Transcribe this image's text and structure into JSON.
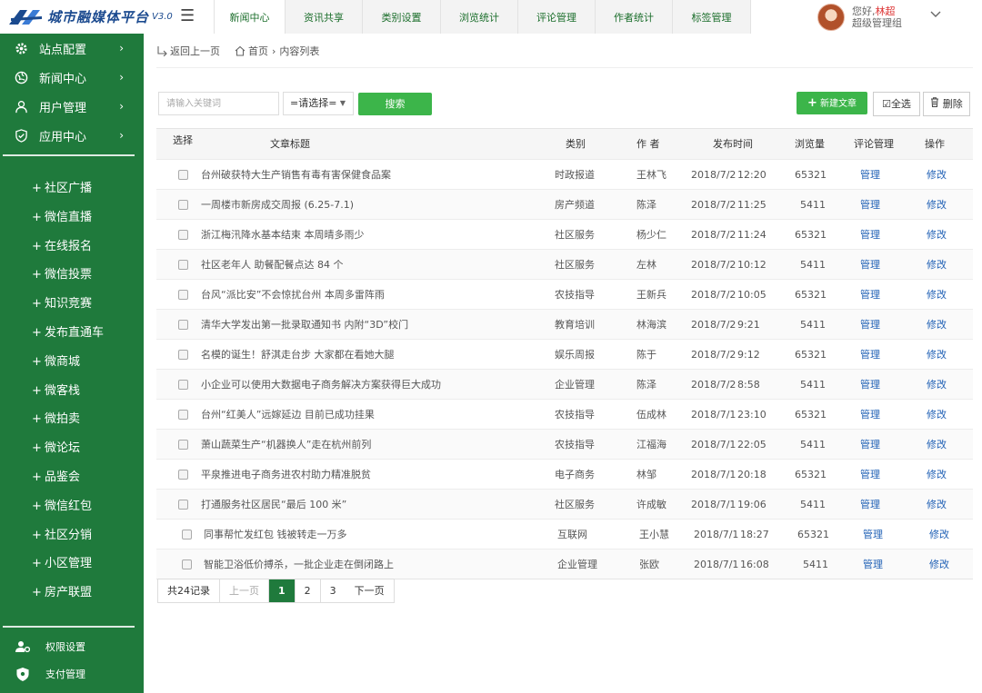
{
  "logo": {
    "text": "城市融媒体平台",
    "version": "V3.0"
  },
  "topnav": {
    "tabs": [
      {
        "label": "新闻中心",
        "active": true
      },
      {
        "label": "资讯共享"
      },
      {
        "label": "类别设置"
      },
      {
        "label": "浏览统计"
      },
      {
        "label": "评论管理"
      },
      {
        "label": "作者统计"
      },
      {
        "label": "标签管理"
      }
    ]
  },
  "user": {
    "greeting": "您好,",
    "name": "林超",
    "role": "超级管理组"
  },
  "sidebar": {
    "groups": [
      {
        "label": "站点配置",
        "icon": "gear-icon"
      },
      {
        "label": "新闻中心",
        "icon": "globe-icon"
      },
      {
        "label": "用户管理",
        "icon": "user-icon"
      },
      {
        "label": "应用中心",
        "icon": "shield-icon"
      }
    ],
    "items": [
      "社区广播",
      "微信直播",
      "在线报名",
      "微信投票",
      "知识竞赛",
      "发布直通车",
      "微商城",
      "微客栈",
      "微拍卖",
      "微论坛",
      "品鉴会",
      "微信红包",
      "社区分销",
      "小区管理",
      "房产联盟"
    ],
    "bottom": [
      {
        "label": "权限设置",
        "icon": "user-settings-icon"
      },
      {
        "label": "支付管理",
        "icon": "payment-shield-icon"
      }
    ]
  },
  "breadcrumb": {
    "back": "返回上一页",
    "home": "首页",
    "current": "内容列表"
  },
  "toolbar": {
    "search_placeholder": "请输入关键词",
    "category_select": "=请选择=",
    "search_label": "搜索",
    "new_label": "新建文章",
    "select_all_label": "全选",
    "delete_label": "删除"
  },
  "table": {
    "headers": {
      "select": "选择",
      "title": "文章标题",
      "category": "类别",
      "author": "作 者",
      "date": "发布时间",
      "views": "浏览量",
      "comments": "评论管理",
      "action": "操作"
    },
    "rows": [
      {
        "title": "台州破获特大生产销售有毒有害保健食品案",
        "category": "时政报道",
        "author": "王林飞",
        "date": "2018/7/2",
        "time": "12:20",
        "views": "65321",
        "comment": "管理",
        "action": "修改"
      },
      {
        "title": "一周楼市新房成交周报 (6.25-7.1)",
        "category": "房产频道",
        "author": "陈泽",
        "date": "2018/7/2",
        "time": "11:25",
        "views": "5411",
        "comment": "管理",
        "action": "修改"
      },
      {
        "title": "浙江梅汛降水基本结束 本周晴多雨少",
        "category": "社区服务",
        "author": "杨少仁",
        "date": "2018/7/2",
        "time": "11:24",
        "views": "65321",
        "comment": "管理",
        "action": "修改"
      },
      {
        "title": "社区老年人 助餐配餐点达 84 个",
        "category": "社区服务",
        "author": "左林",
        "date": "2018/7/2",
        "time": "10:12",
        "views": "5411",
        "comment": "管理",
        "action": "修改"
      },
      {
        "title": "台风“派比安”不会惊扰台州 本周多雷阵雨",
        "category": "农技指导",
        "author": "王新兵",
        "date": "2018/7/2",
        "time": "10:05",
        "views": "65321",
        "comment": "管理",
        "action": "修改"
      },
      {
        "title": "清华大学发出第一批录取通知书 内附“3D”校门",
        "category": "教育培训",
        "author": "林海滨",
        "date": "2018/7/2",
        "time": "9:21",
        "views": "5411",
        "comment": "管理",
        "action": "修改"
      },
      {
        "title": "名模的诞生！舒淇走台步 大家都在看她大腿",
        "category": "娱乐周报",
        "author": "陈于",
        "date": "2018/7/2",
        "time": "9:12",
        "views": "65321",
        "comment": "管理",
        "action": "修改"
      },
      {
        "title": "小企业可以使用大数据电子商务解决方案获得巨大成功",
        "category": "企业管理",
        "author": "陈泽",
        "date": "2018/7/2",
        "time": "8:58",
        "views": "5411",
        "comment": "管理",
        "action": "修改"
      },
      {
        "title": "台州“红美人”远嫁延边 目前已成功挂果",
        "category": "农技指导",
        "author": "伍成林",
        "date": "2018/7/1",
        "time": "23:10",
        "views": "65321",
        "comment": "管理",
        "action": "修改"
      },
      {
        "title": "萧山蔬菜生产“机器换人”走在杭州前列",
        "category": "农技指导",
        "author": "江福海",
        "date": "2018/7/1",
        "time": "22:05",
        "views": "5411",
        "comment": "管理",
        "action": "修改"
      },
      {
        "title": "平泉推进电子商务进农村助力精准脱贫",
        "category": "电子商务",
        "author": "林邹",
        "date": "2018/7/1",
        "time": "20:18",
        "views": "65321",
        "comment": "管理",
        "action": "修改"
      },
      {
        "title": "打通服务社区居民“最后 100 米”",
        "category": "社区服务",
        "author": "许成敏",
        "date": "2018/7/1",
        "time": "19:06",
        "views": "5411",
        "comment": "管理",
        "action": "修改"
      },
      {
        "title": "同事帮忙发红包 钱被转走一万多",
        "category": "互联网",
        "author": "王小慧",
        "date": "2018/7/1",
        "time": "18:27",
        "views": "65321",
        "comment": "管理",
        "action": "修改"
      },
      {
        "title": "智能卫浴低价搏杀，一批企业走在倒闭路上",
        "category": "企业管理",
        "author": "张欧",
        "date": "2018/7/1",
        "time": "16:08",
        "views": "5411",
        "comment": "管理",
        "action": "修改"
      }
    ]
  },
  "pagination": {
    "total": "共24记录",
    "prev": "上一页",
    "pages": [
      "1",
      "2",
      "3"
    ],
    "current": "1",
    "next": "下一页"
  },
  "colors": {
    "sidebar": "#1f7a3c",
    "accent": "#3cb54a",
    "link": "#2262b6"
  }
}
